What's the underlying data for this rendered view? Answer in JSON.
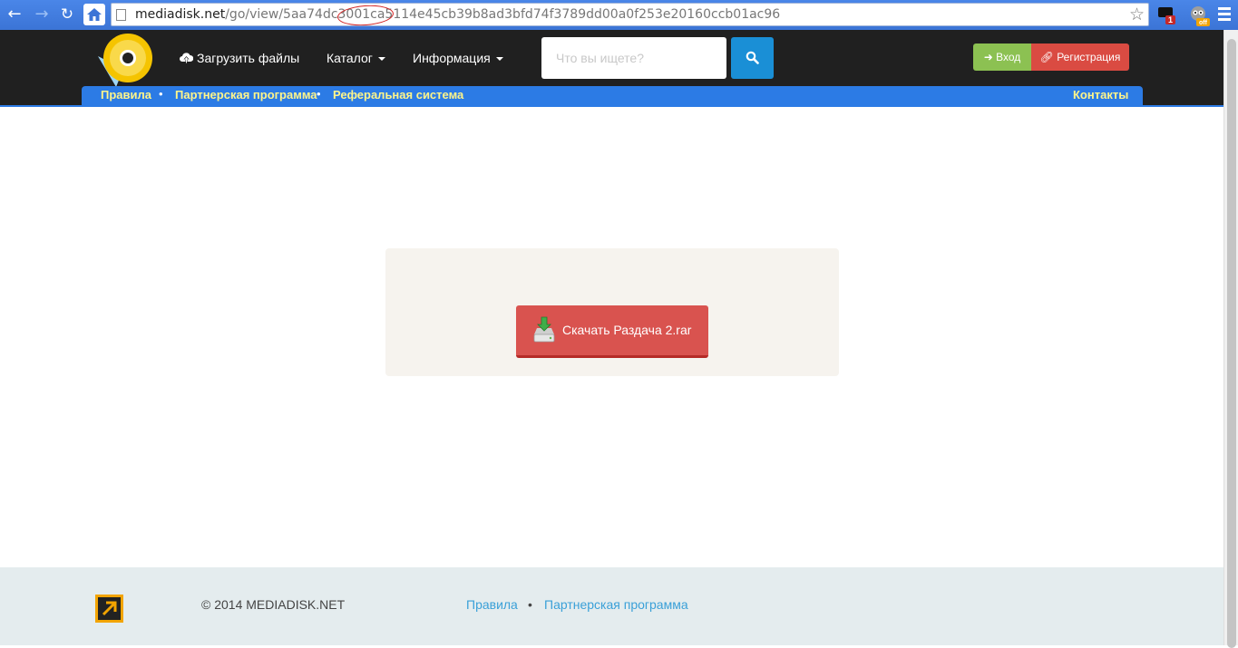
{
  "browser": {
    "url_host": "mediadisk.net",
    "url_path": "/go/view/5aa74dc3001ca5114e45cb39b8ad3bfd74f3789dd00a0f253e20160ccb01ac96",
    "ext_badge": "1",
    "ext_badge2": "off"
  },
  "header": {
    "upload_label": "Загрузить файлы",
    "catalog_label": "Каталог",
    "info_label": "Информация",
    "search_placeholder": "Что вы ищете?",
    "login_label": "Вход",
    "register_label": "Регистрация"
  },
  "subnav": {
    "rules": "Правила",
    "partner": "Партнерская программа",
    "referral": "Реферальная система",
    "contacts": "Контакты"
  },
  "main": {
    "download_label": "Скачать Раздача 2.rar"
  },
  "footer": {
    "copyright": "© 2014 MEDIADISK.NET",
    "rules": "Правила",
    "partner": "Партнерская программа"
  },
  "colors": {
    "header_bg": "#202020",
    "subnav_bg": "#2c7be5",
    "download_btn": "#d9534f",
    "login_btn": "#8cc152",
    "register_btn": "#da4b42"
  }
}
